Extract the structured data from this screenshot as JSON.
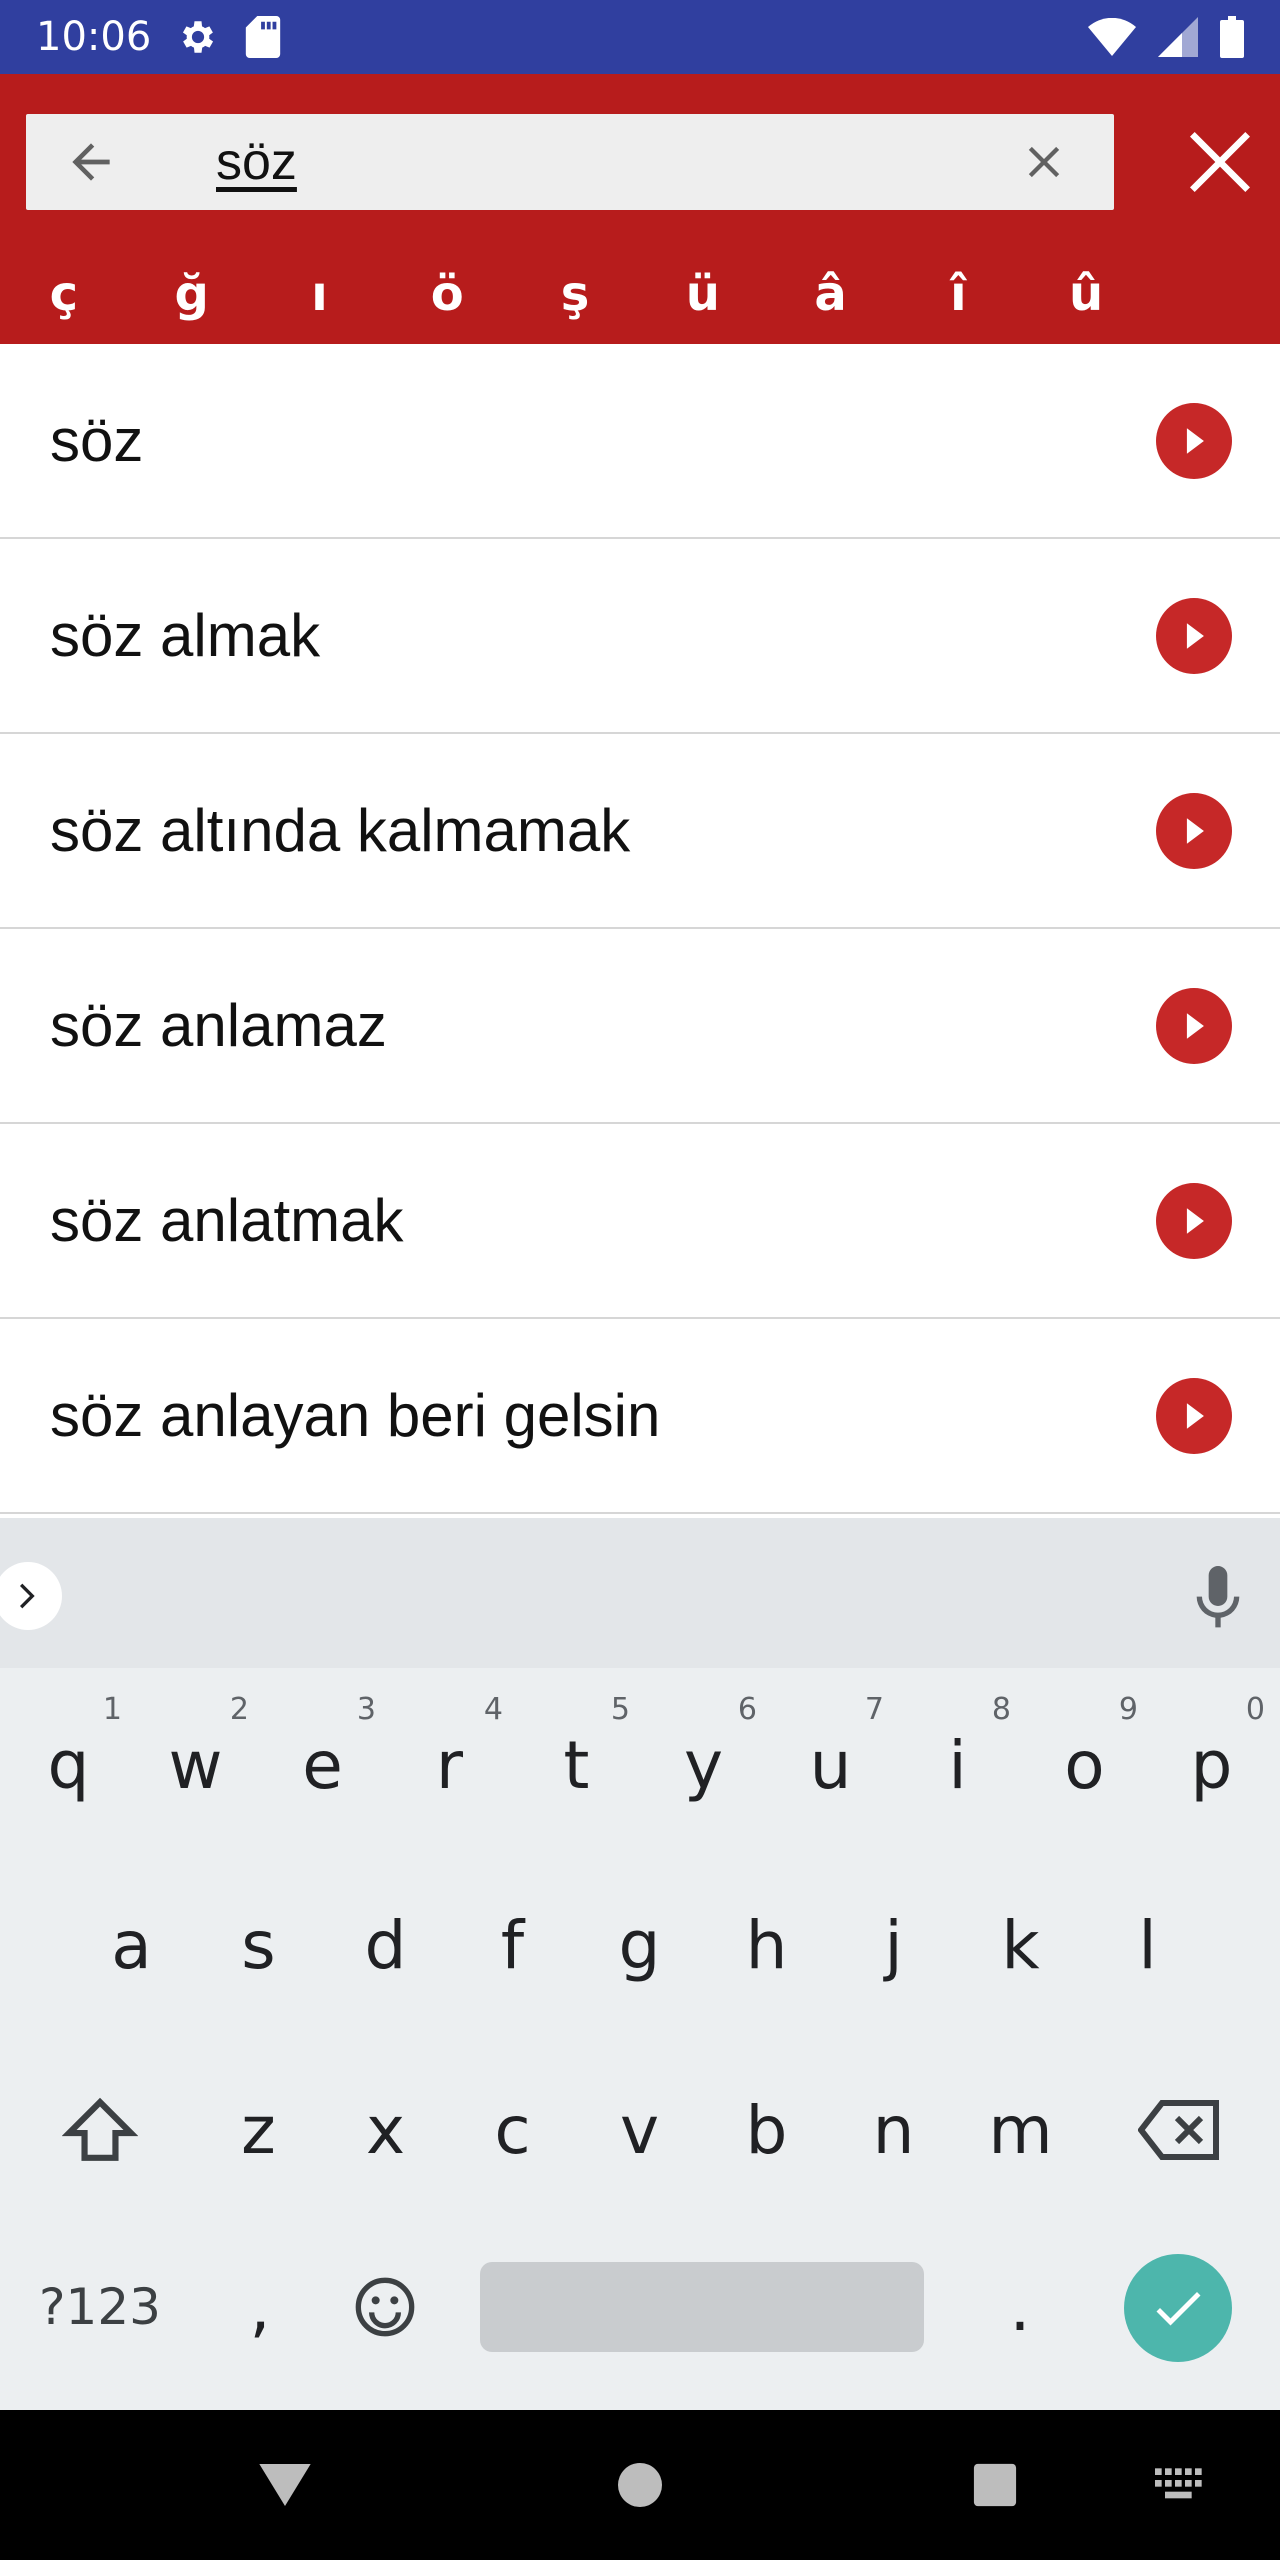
{
  "status": {
    "time": "10:06"
  },
  "search": {
    "query": "söz"
  },
  "special_chars": [
    "ç",
    "ğ",
    "ı",
    "ö",
    "ş",
    "ü",
    "â",
    "î",
    "û"
  ],
  "results": [
    {
      "label": "söz"
    },
    {
      "label": "söz almak"
    },
    {
      "label": "söz altında kalmamak"
    },
    {
      "label": "söz anlamaz"
    },
    {
      "label": "söz anlatmak"
    },
    {
      "label": "söz anlayan beri gelsin"
    }
  ],
  "keyboard": {
    "row1": [
      {
        "k": "q",
        "h": "1"
      },
      {
        "k": "w",
        "h": "2"
      },
      {
        "k": "e",
        "h": "3"
      },
      {
        "k": "r",
        "h": "4"
      },
      {
        "k": "t",
        "h": "5"
      },
      {
        "k": "y",
        "h": "6"
      },
      {
        "k": "u",
        "h": "7"
      },
      {
        "k": "i",
        "h": "8"
      },
      {
        "k": "o",
        "h": "9"
      },
      {
        "k": "p",
        "h": "0"
      }
    ],
    "row2": [
      "a",
      "s",
      "d",
      "f",
      "g",
      "h",
      "j",
      "k",
      "l"
    ],
    "row3": [
      "z",
      "x",
      "c",
      "v",
      "b",
      "n",
      "m"
    ],
    "symbols_label": "?123",
    "comma": ",",
    "period": "."
  },
  "colors": {
    "header": "#B71C1C",
    "status_bar": "#303F9F",
    "accent_teal": "#4DB6AC"
  }
}
